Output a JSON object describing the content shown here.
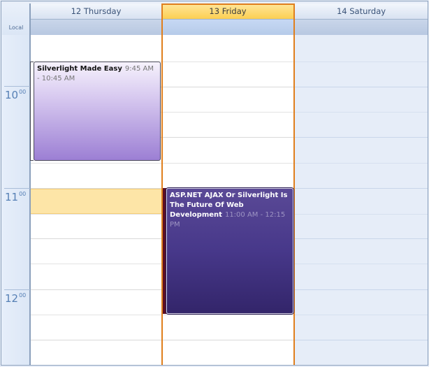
{
  "scheduler": {
    "timezone_label": "Local",
    "days": [
      {
        "label": "12 Thursday"
      },
      {
        "label": "13 Friday"
      },
      {
        "label": "14 Saturday"
      }
    ],
    "hours": [
      {
        "hour": "10",
        "minutes": "00"
      },
      {
        "hour": "11",
        "minutes": "00"
      },
      {
        "hour": "12",
        "minutes": "00"
      }
    ],
    "appointments": [
      {
        "title": "Silverlight Made Easy",
        "time": "9:45 AM - 10:45 AM",
        "day": "12 Thursday"
      },
      {
        "title": "ASP.NET AJAX Or Silverlight Is The Future Of Web Development",
        "time": "11:00 AM - 12:15 PM",
        "day": "13 Friday"
      }
    ]
  },
  "colors": {
    "today_accent": "#e07f1d",
    "appointment_1": "#9c7fd4",
    "appointment_2": "#47388a",
    "highlight_slot": "#fde5a7"
  }
}
